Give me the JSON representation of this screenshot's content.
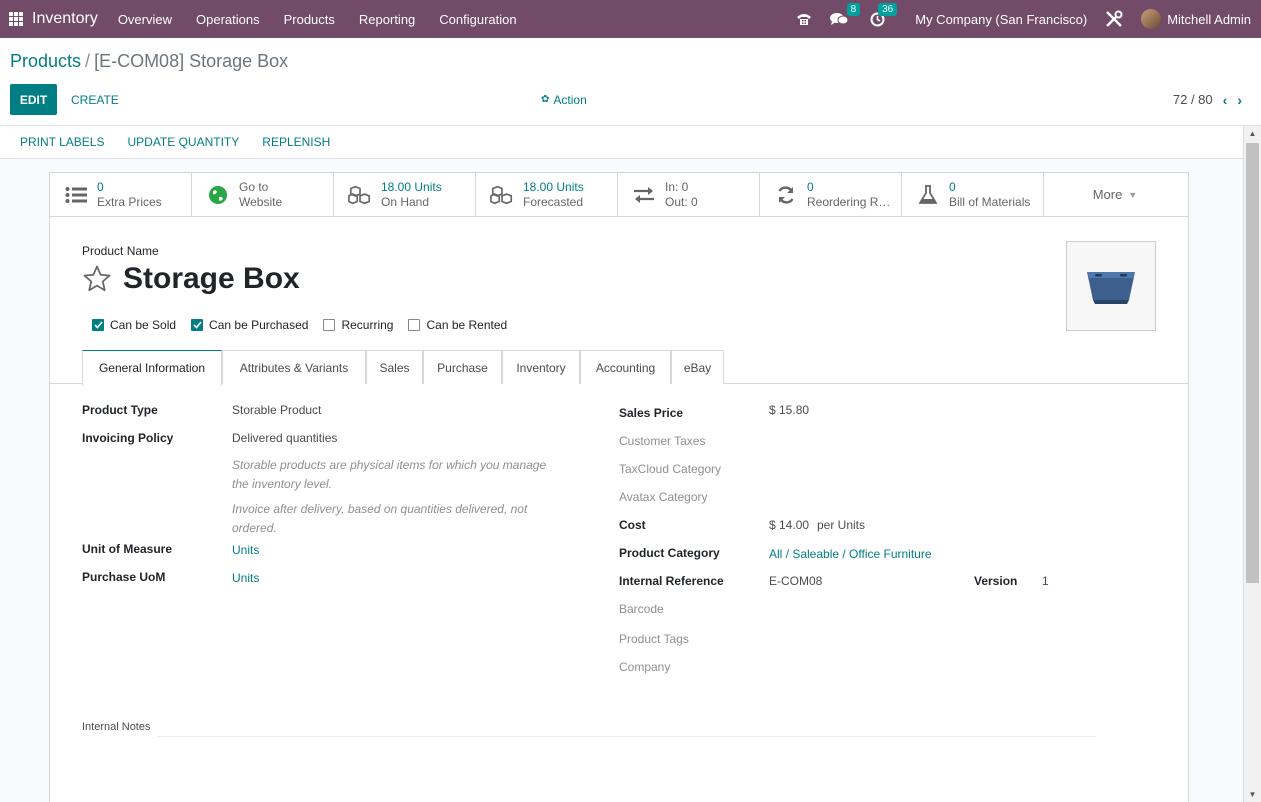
{
  "navbar": {
    "brand": "Inventory",
    "menu": [
      "Overview",
      "Operations",
      "Products",
      "Reporting",
      "Configuration"
    ],
    "messages_count": "8",
    "activities_count": "36",
    "company": "My Company (San Francisco)",
    "user": "Mitchell Admin"
  },
  "breadcrumb": {
    "parent": "Products",
    "separator": "/",
    "current": "[E-COM08] Storage Box"
  },
  "buttons": {
    "edit": "EDIT",
    "create": "CREATE",
    "action": "Action"
  },
  "pager": {
    "value": "72 / 80"
  },
  "header_buttons": [
    "PRINT LABELS",
    "UPDATE QUANTITY",
    "REPLENISH"
  ],
  "smart_buttons": [
    {
      "value": "0",
      "label": "Extra Prices",
      "icon": "list-icon"
    },
    {
      "value": "Go to",
      "label": "Website",
      "icon": "globe-icon"
    },
    {
      "value": "18.00 Units",
      "label": "On Hand",
      "icon": "cubes-icon"
    },
    {
      "value": "18.00 Units",
      "label": "Forecasted",
      "icon": "cubes-icon"
    },
    {
      "value": "In: 0",
      "label": "Out: 0",
      "icon": "exchange-icon"
    },
    {
      "value": "0",
      "label": "Reordering Rules",
      "icon": "refresh-icon"
    },
    {
      "value": "0",
      "label": "Bill of Materials",
      "icon": "flask-icon"
    }
  ],
  "more_label": "More",
  "product": {
    "name_label": "Product Name",
    "name": "Storage Box",
    "checkboxes": [
      {
        "label": "Can be Sold",
        "checked": true
      },
      {
        "label": "Can be Purchased",
        "checked": true
      },
      {
        "label": "Recurring",
        "checked": false
      },
      {
        "label": "Can be Rented",
        "checked": false
      }
    ]
  },
  "tabs": [
    "General Information",
    "Attributes & Variants",
    "Sales",
    "Purchase",
    "Inventory",
    "Accounting",
    "eBay"
  ],
  "left_fields": {
    "product_type_label": "Product Type",
    "product_type": "Storable Product",
    "invoicing_policy_label": "Invoicing Policy",
    "invoicing_policy": "Delivered quantities",
    "help_storable_1": "Storable products are physical items for which you manage",
    "help_storable_2": "the inventory level.",
    "help_invoice_1": "Invoice after delivery, based on quantities delivered, not",
    "help_invoice_2": "ordered.",
    "uom_label": "Unit of Measure",
    "uom": "Units",
    "purchase_uom_label": "Purchase UoM",
    "purchase_uom": "Units"
  },
  "right_fields": {
    "sales_price_label": "Sales Price",
    "sales_price": "$ 15.80",
    "customer_taxes_label": "Customer Taxes",
    "taxcloud_label": "TaxCloud Category",
    "avatax_label": "Avatax Category",
    "cost_label": "Cost",
    "cost": "$ 14.00",
    "cost_unit": "per Units",
    "category_label": "Product Category",
    "category": "All / Saleable / Office Furniture",
    "internal_ref_label": "Internal Reference",
    "internal_ref": "E-COM08",
    "version_label": "Version",
    "version": "1",
    "barcode_label": "Barcode",
    "tags_label": "Product Tags",
    "company_label": "Company"
  },
  "notes_label": "Internal Notes",
  "colors": {
    "navbar": "#714b67",
    "accent": "#017e84",
    "badge": "#00a09d"
  }
}
